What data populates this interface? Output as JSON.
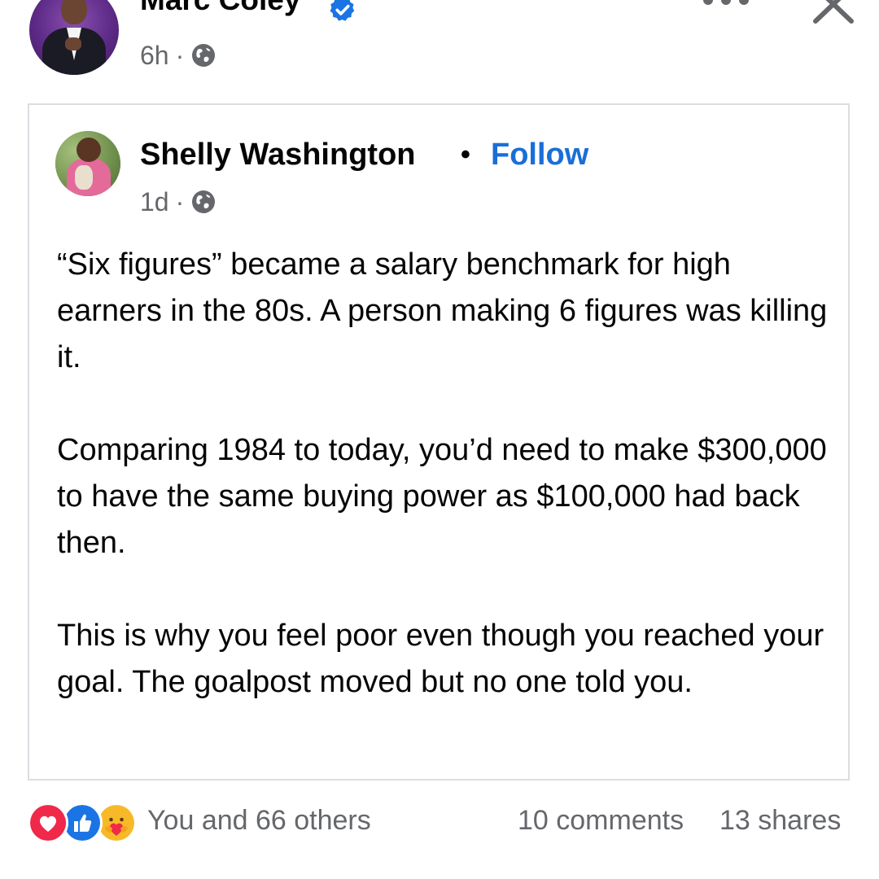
{
  "post": {
    "author": "Marc Coley",
    "time": "6h",
    "separator": "·",
    "audience_icon": "globe-icon",
    "verified_icon": "verified-badge-icon",
    "colors": {
      "verified": "#1b74e4",
      "meta_text": "#65676b",
      "link": "#1a6ed8"
    }
  },
  "shared_post": {
    "author": "Shelly Washington",
    "separator": "•",
    "follow_label": "Follow",
    "time": "1d",
    "meta_separator": "·",
    "audience_icon": "globe-icon",
    "paragraphs": [
      "“Six figures” became a salary benchmark for high earners in the 80s. A person making 6 figures was killing it.",
      "Comparing 1984 to today, you’d need to make $300,000 to have the same buying power as $100,000 had back then.",
      "This is why you feel poor even though you reached your goal. The goalpost moved but no one told you."
    ]
  },
  "footer": {
    "reaction_icons": [
      "love-reaction-icon",
      "like-reaction-icon",
      "care-reaction-icon"
    ],
    "reactions_text": "You and 66 others",
    "comments_text": "10 comments",
    "shares_text": "13 shares"
  }
}
